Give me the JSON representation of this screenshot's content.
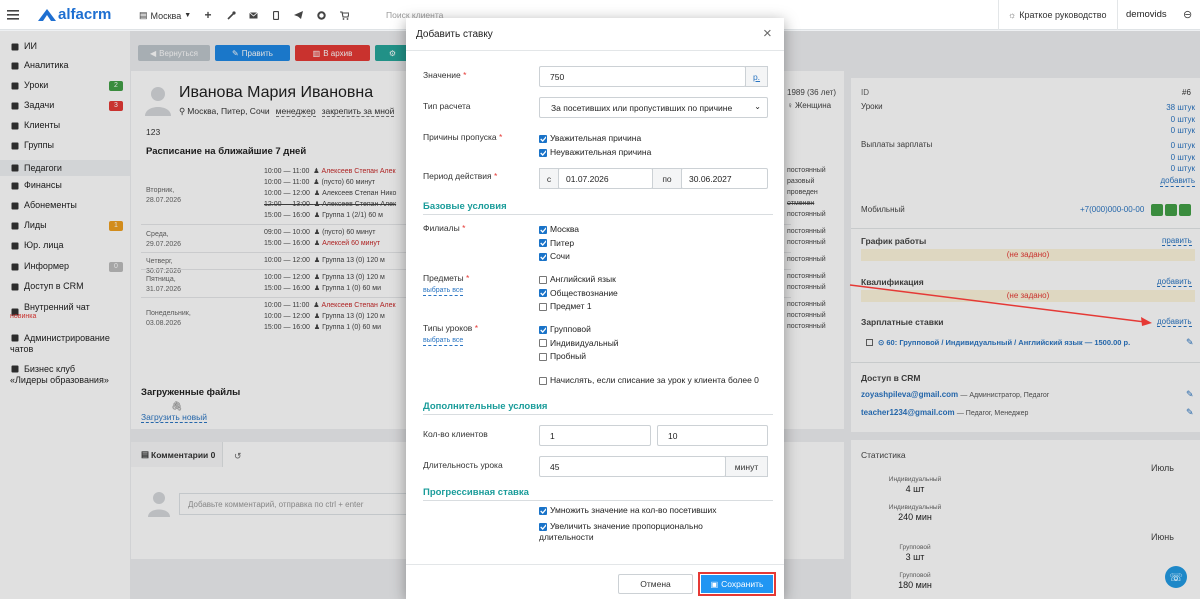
{
  "topbar": {
    "logo_text": "alfacrm",
    "branch": "Москва",
    "search_placeholder": "Поиск клиента",
    "guide_label": "Краткое руководство",
    "username": "demovids"
  },
  "sidebar": {
    "items": [
      {
        "label": "ИИ",
        "icon": "sparkle-icon"
      },
      {
        "label": "Аналитика",
        "icon": "analytics-icon"
      },
      {
        "label": "Уроки",
        "icon": "calendar-icon",
        "badge": "2",
        "badge_color": "#43a047"
      },
      {
        "label": "Задачи",
        "icon": "tasks-icon",
        "badge": "3",
        "badge_color": "#e53935"
      },
      {
        "label": "Клиенты",
        "icon": "user-icon"
      },
      {
        "label": "Группы",
        "icon": "group-icon"
      },
      {
        "label": "Педагоги",
        "icon": "teacher-icon"
      },
      {
        "label": "Финансы",
        "icon": "money-icon"
      },
      {
        "label": "Абонементы",
        "icon": "tag-icon"
      },
      {
        "label": "Лиды",
        "icon": "leads-icon",
        "badge": "1",
        "badge_color": "#f0a020"
      },
      {
        "label": "Юр. лица",
        "icon": "briefcase-icon"
      },
      {
        "label": "Информер",
        "icon": "informer-icon",
        "badge": "0",
        "badge_color": "#bdbdbd"
      },
      {
        "label": "Доступ в CRM",
        "icon": "lock-icon"
      },
      {
        "label": "Внутренний чат",
        "icon": "chat-icon",
        "sublabel": "новинка"
      },
      {
        "label": "Администрирование",
        "label2": "чатов",
        "icon": "admin-chat-icon"
      },
      {
        "label": "Бизнес клуб",
        "label2": "«Лидеры образования»",
        "icon": "star-icon"
      }
    ]
  },
  "profile": {
    "toolbar": {
      "back": "Вернуться",
      "edit": "Править",
      "archive": "В архив"
    },
    "name": "Иванова Мария Ивановна",
    "location": "Москва, Питер, Сочи",
    "role": "менеджер",
    "pin": "закрепить за мной",
    "number": "123",
    "schedule_title": "Расписание на ближайшие 7 дней",
    "schedule": [
      {
        "day": "Вторник,",
        "date": "28.07.2026",
        "lines": [
          {
            "time": "10:00 — 11:00",
            "who": "Алексеев Степан Алек",
            "right": "постоянный",
            "who_red": true
          },
          {
            "time": "10:00 — 11:00",
            "who": "(пусто)  60 минут",
            "right": "разовый"
          },
          {
            "time": "10:00 — 12:00",
            "who": "Алексеев Степан Нико",
            "right": "проведен"
          },
          {
            "time": "12:00 — 13:00",
            "who": "Алексеев Степан Алек",
            "right": "отменен",
            "strike": true
          },
          {
            "time": "15:00 — 16:00",
            "who": "Группа 1 (2/1)  60 м",
            "right": "постоянный"
          }
        ]
      },
      {
        "day": "Среда,",
        "date": "29.07.2026",
        "lines": [
          {
            "time": "09:00 — 10:00",
            "who": "(пусто)  60 минут",
            "right": "постоянный"
          },
          {
            "time": "15:00 — 16:00",
            "who": "Алексей  60 минут",
            "right": "постоянный",
            "who_red": true
          }
        ]
      },
      {
        "day": "Четверг,",
        "date": "30.07.2026",
        "lines": [
          {
            "time": "10:00 — 12:00",
            "who": "Группа 13 (0)  120 м",
            "right": "постоянный"
          }
        ]
      },
      {
        "day": "Пятница,",
        "date": "31.07.2026",
        "lines": [
          {
            "time": "10:00 — 12:00",
            "who": "Группа 13 (0)  120 м",
            "right": "постоянный"
          },
          {
            "time": "15:00 — 16:00",
            "who": "Группа 1 (0)  60 ми",
            "right": "постоянный"
          }
        ]
      },
      {
        "day": "Понедельник,",
        "date": "03.08.2026",
        "lines": [
          {
            "time": "10:00 — 11:00",
            "who": "Алексеев Степан Алек",
            "right": "постоянный",
            "who_red": true
          },
          {
            "time": "10:00 — 12:00",
            "who": "Группа 13 (0)  120 м",
            "right": "постоянный"
          },
          {
            "time": "15:00 — 16:00",
            "who": "Группа 1 (0)  60 ми",
            "right": "постоянный"
          }
        ]
      }
    ],
    "files_title": "Загруженные файлы",
    "upload": "Загрузить новый",
    "comments_tab": "Комментарии 0",
    "comment_placeholder": "Добавьте комментарий, отправка по ctrl + enter",
    "birth": "1989 (36 лет)",
    "gender": "Женщина"
  },
  "right": {
    "id_label": "ID",
    "id_value": "#6",
    "lessons_label": "Уроки",
    "lessons_values": [
      "38 штук",
      "0 штук",
      "0 штук"
    ],
    "payouts_label": "Выплаты зарплаты",
    "payouts_values": [
      "0 штук",
      "0 штук",
      "0 штук"
    ],
    "add": "добавить",
    "mobile_label": "Мобильный",
    "mobile_value": "+7(000)000-00-00",
    "schedule_label": "График работы",
    "edit": "править",
    "not_set": "(не задано)",
    "qual_label": "Квалификация",
    "rates_label": "Зарплатные ставки",
    "rate_item": "60: Групповой / Индивидуальный / Английский язык — 1500.00 р.",
    "crm_label": "Доступ в CRM",
    "crm_users": [
      {
        "email": "zoyashpileva@gmail.com",
        "roles": "— Администратор, Педагог"
      },
      {
        "email": "teacher1234@gmail.com",
        "roles": "— Педагог, Менеджер"
      }
    ],
    "stats_label": "Статистика",
    "stats": [
      {
        "label": "Индивидуальный",
        "value": "4 шт"
      },
      {
        "label": "Индивидуальный",
        "value": "240 мин"
      },
      {
        "label": "Групповой",
        "value": "3 шт"
      },
      {
        "label": "Групповой",
        "value": "180 мин"
      }
    ],
    "month1": "Июль",
    "month2": "Июнь"
  },
  "modal": {
    "title": "Добавить ставку",
    "value_label": "Значение",
    "value": "750",
    "currency": "р.",
    "calc_label": "Тип расчета",
    "calc_value": "За посетивших или пропустивших по причине",
    "skip_label": "Причины пропуска",
    "skip_options": [
      {
        "label": "Уважительная причина",
        "checked": true
      },
      {
        "label": "Неуважительная причина",
        "checked": true
      }
    ],
    "period_label": "Период действия",
    "period_from_prefix": "с",
    "period_from": "01.07.2026",
    "period_to_prefix": "по",
    "period_to": "30.06.2027",
    "base_section": "Базовые условия",
    "branches_label": "Филиалы",
    "branches": [
      {
        "label": "Москва",
        "checked": true
      },
      {
        "label": "Питер",
        "checked": true
      },
      {
        "label": "Сочи",
        "checked": true
      }
    ],
    "subjects_label": "Предметы",
    "select_all": "выбрать все",
    "subjects": [
      {
        "label": "Английский язык",
        "checked": false
      },
      {
        "label": "Обществознание",
        "checked": true
      },
      {
        "label": "Предмет 1",
        "checked": false
      }
    ],
    "lesson_types_label": "Типы уроков",
    "lesson_types": [
      {
        "label": "Групповой",
        "checked": true
      },
      {
        "label": "Индивидуальный",
        "checked": false
      },
      {
        "label": "Пробный",
        "checked": false
      }
    ],
    "charge_option": "Начислять, если списание за урок у клиента более 0",
    "extra_section": "Дополнительные условия",
    "clients_label": "Кол-во клиентов",
    "clients_min": "1",
    "clients_max": "10",
    "duration_label": "Длительность урока",
    "duration_value": "45",
    "duration_unit": "минут",
    "progressive_section": "Прогрессивная ставка",
    "progressive": [
      {
        "label": "Умножить значение на кол-во посетивших",
        "checked": true
      },
      {
        "label": "Увеличить значение пропорционально",
        "label2": "длительности",
        "checked": true
      }
    ],
    "cancel": "Отмена",
    "save": "Сохранить"
  },
  "colors": {
    "accent": "#2a75c2",
    "teal": "#1a9c9a",
    "save_bg": "#2196f3",
    "highlight": "#e53935",
    "btn_edit": "#1e88e5",
    "btn_archive": "#e53935",
    "btn_green": "#26a69a"
  }
}
